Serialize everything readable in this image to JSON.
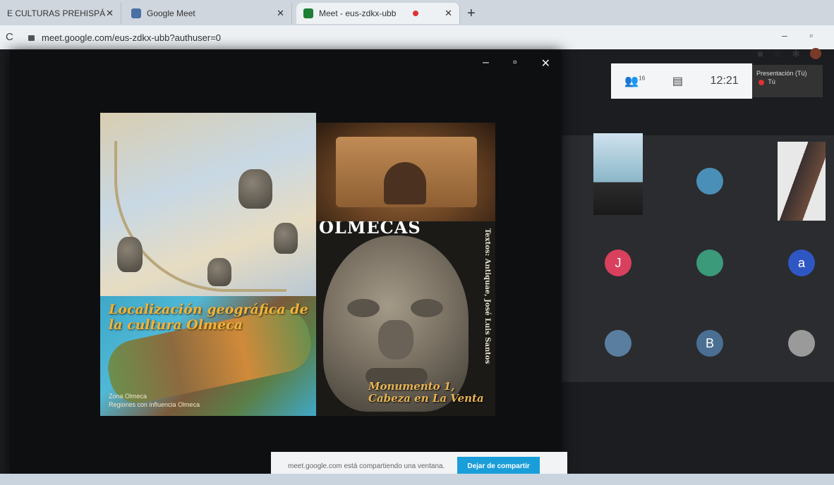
{
  "browser": {
    "tabs": [
      {
        "label": "E CULTURAS PREHISPÁ",
        "favicon_color": "#ffffff"
      },
      {
        "label": "Google Meet",
        "favicon_color": "#4a6fa5"
      },
      {
        "label": "Meet - eus-zdkx-ubb",
        "favicon_color": "#1e7e34"
      }
    ],
    "url": "meet.google.com/eus-zdkx-ubb?authuser=0"
  },
  "meet": {
    "participants_count": "16",
    "time": "12:21",
    "presenting_label": "Presentación (Tú)",
    "you_label": "Tú",
    "participants": [
      {
        "type": "photo"
      },
      {
        "type": "avatar",
        "color": "#4a8fb8",
        "initial": ""
      },
      {
        "type": "photo2"
      },
      {
        "type": "avatar",
        "color": "#d8405e",
        "initial": "J"
      },
      {
        "type": "avatar",
        "color": "#3a9a7a",
        "initial": ""
      },
      {
        "type": "avatar",
        "color": "#2f57c4",
        "initial": "a"
      },
      {
        "type": "avatar",
        "color": "#5a7ea0",
        "initial": ""
      },
      {
        "type": "avatar",
        "color": "#4a6f93",
        "initial": "B"
      },
      {
        "type": "avatar",
        "color": "#9a9a9a",
        "initial": ""
      }
    ]
  },
  "slide": {
    "map_title": "Localización geográfica de la cultura Olmeca",
    "legend_1": "Zona Olmeca",
    "legend_2": "Regiones con influencia Olmeca",
    "heading": "OLMECAS",
    "side_credit": "Textos: Antiquae, José Luis Santos",
    "monument": "Monumento 1, Cabeza en La Venta"
  },
  "share": {
    "message": "meet.google.com está compartiendo una ventana.",
    "stop_button": "Dejar de compartir"
  }
}
